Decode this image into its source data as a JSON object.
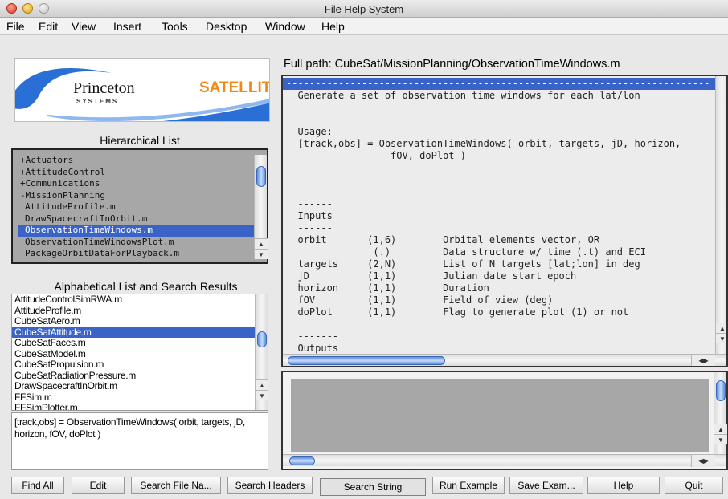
{
  "window": {
    "title": "File Help System"
  },
  "menu": [
    "File",
    "Edit",
    "View",
    "Insert",
    "Tools",
    "Desktop",
    "Window",
    "Help"
  ],
  "logo": {
    "name_part1": "Princeton",
    "name_part2": "SATELLITE",
    "subtitle": "SYSTEMS"
  },
  "hierarchical": {
    "heading": "Hierarchical List",
    "items": [
      "+Actuators",
      "+AttitudeControl",
      "+Communications",
      "-MissionPlanning",
      "AttitudeProfile.m",
      "DrawSpacecraftInOrbit.m",
      "ObservationTimeWindows.m",
      "ObservationTimeWindowsPlot.m",
      "PackageOrbitDataForPlayback.m"
    ],
    "selected_index": 6
  },
  "alphabetical": {
    "heading": "Alphabetical List and Search Results",
    "items": [
      "AttitudeControlSimRWA.m",
      "AttitudeProfile.m",
      "CubeSatAero.m",
      "CubeSatAttitude.m",
      "CubeSatFaces.m",
      "CubeSatModel.m",
      "CubeSatPropulsion.m",
      "CubeSatRadiationPressure.m",
      "DrawSpacecraftInOrbit.m",
      "FFSim.m",
      "FFSimPlotter.m"
    ],
    "selected_index": 3
  },
  "description": "[track,obs] = ObservationTimeWindows( orbit, targets, jD, horizon, fOV, doPlot )",
  "full_path": "Full path: CubeSat/MissionPlanning/ObservationTimeWindows.m",
  "code_lines": [
    "-------------------------------------------------------------------------",
    "  Generate a set of observation time windows for each lat/lon",
    "-------------------------------------------------------------------------",
    "",
    "  Usage:",
    "  [track,obs] = ObservationTimeWindows( orbit, targets, jD, horizon,",
    "                  fOV, doPlot )",
    "-------------------------------------------------------------------------",
    "",
    "",
    "  ------",
    "  Inputs",
    "  ------",
    "  orbit       (1,6)        Orbital elements vector, OR",
    "               (.)         Data structure w/ time (.t) and ECI",
    "  targets     (2,N)        List of N targets [lat;lon] in deg",
    "  jD          (1,1)        Julian date start epoch",
    "  horizon     (1,1)        Duration",
    "  fOV         (1,1)        Field of view (deg)",
    "  doPlot      (1,1)        Flag to generate plot (1) or not",
    "",
    "  -------",
    "  Outputs",
    "  -------"
  ],
  "buttons": [
    "Find All",
    "Edit",
    "Search File Na...",
    "Search Headers",
    "Search String",
    "Run Example",
    "Save Exam...",
    "Help",
    "Quit"
  ],
  "colors": {
    "selection": "#3a63c8",
    "logo_orange": "#f08a14",
    "logo_blue": "#2a6fd6"
  },
  "icons": {
    "scroll_up": "▲",
    "scroll_down": "▼",
    "scroll_left": "◀",
    "scroll_right": "▶"
  }
}
